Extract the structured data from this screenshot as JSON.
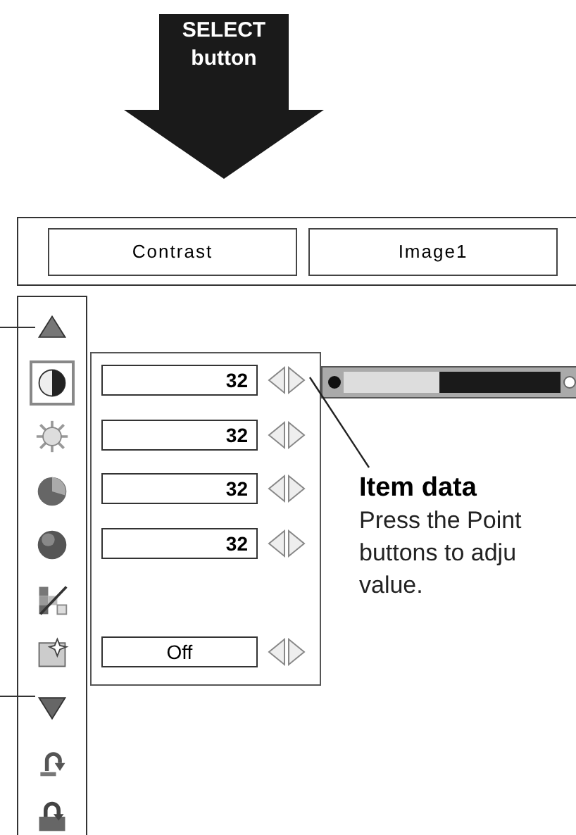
{
  "select_arrow": {
    "label": "SELECT button"
  },
  "header": {
    "items": [
      "Contrast",
      "Image1"
    ]
  },
  "sidebar": {
    "items": [
      {
        "kind": "up"
      },
      {
        "kind": "contrast",
        "selected": true,
        "field": {
          "kind": "number",
          "value": "32"
        }
      },
      {
        "kind": "brightness",
        "selected": false,
        "field": {
          "kind": "number",
          "value": "32"
        }
      },
      {
        "kind": "color",
        "selected": false,
        "field": {
          "kind": "number",
          "value": "32"
        }
      },
      {
        "kind": "tint",
        "selected": false,
        "field": {
          "kind": "number",
          "value": "32"
        }
      },
      {
        "kind": "sharpness",
        "selected": false
      },
      {
        "kind": "gamma",
        "selected": false,
        "field": {
          "kind": "option",
          "value": "Off"
        }
      },
      {
        "kind": "down"
      },
      {
        "kind": "reset",
        "selected": false
      },
      {
        "kind": "store",
        "selected": false
      }
    ]
  },
  "slider": {
    "level": 0.44
  },
  "callout": {
    "title": "Item data",
    "text": "Press the Point\nbuttons to adju\nvalue."
  }
}
